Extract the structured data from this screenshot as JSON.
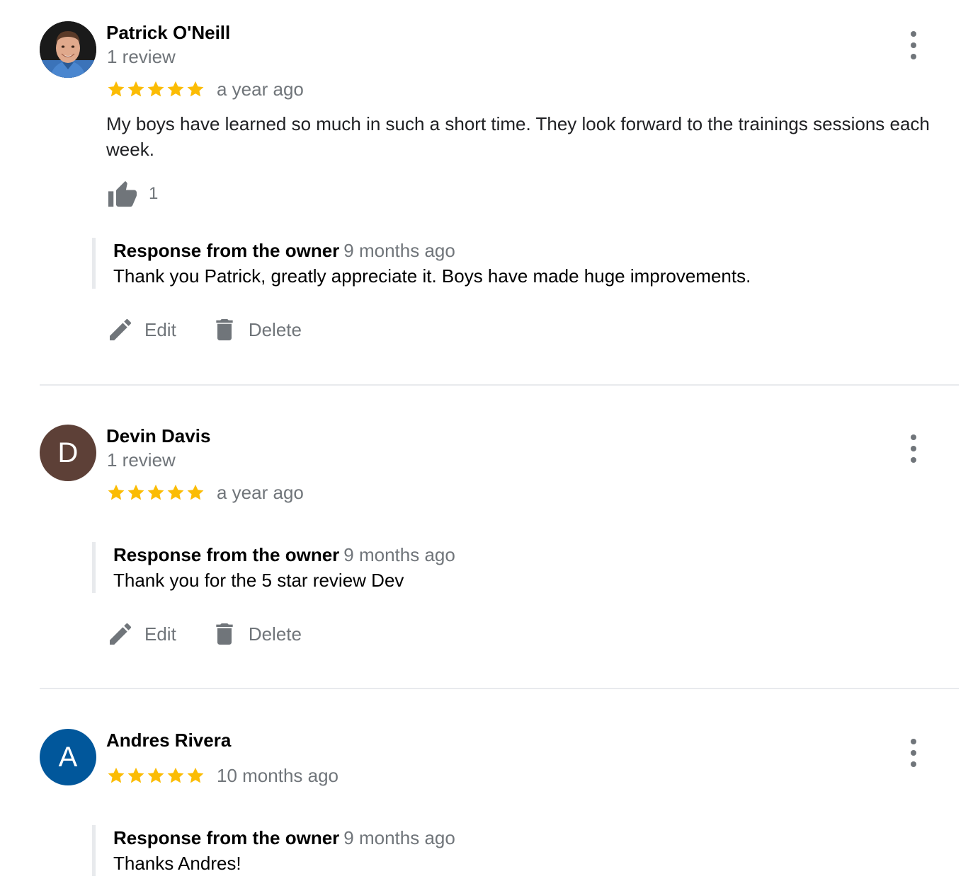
{
  "reviews": [
    {
      "reviewer_name": "Patrick O'Neill",
      "review_count": "1 review",
      "rating": 5,
      "time": "a year ago",
      "text": "My boys have learned so much in such a short time. They look forward to the trainings sessions each week.",
      "likes": "1",
      "avatar": {
        "type": "photo",
        "icon": "person-photo-icon"
      },
      "response": {
        "title": "Response from the owner",
        "time": "9 months ago",
        "text": "Thank you Patrick, greatly appreciate it. Boys have made huge improvements."
      },
      "actions": {
        "edit_label": "Edit",
        "delete_label": "Delete"
      }
    },
    {
      "reviewer_name": "Devin Davis",
      "review_count": "1 review",
      "rating": 5,
      "time": "a year ago",
      "avatar": {
        "type": "letter",
        "letter": "D",
        "color": "#5d4037"
      },
      "response": {
        "title": "Response from the owner",
        "time": "9 months ago",
        "text": "Thank you for the 5 star review Dev"
      },
      "actions": {
        "edit_label": "Edit",
        "delete_label": "Delete"
      }
    },
    {
      "reviewer_name": "Andres Rivera",
      "rating": 5,
      "time": "10 months ago",
      "avatar": {
        "type": "letter",
        "letter": "A",
        "color": "#01579b"
      },
      "response": {
        "title": "Response from the owner",
        "time": "9 months ago",
        "text": "Thanks Andres!"
      }
    }
  ],
  "colors": {
    "star": "#fbbc04",
    "icon": "#70757a",
    "divider": "#e8eaed"
  },
  "icons": {
    "star": "star-icon",
    "thumb": "thumbs-up-icon",
    "edit": "pencil-icon",
    "delete": "trash-icon",
    "more": "more-vertical-icon"
  }
}
